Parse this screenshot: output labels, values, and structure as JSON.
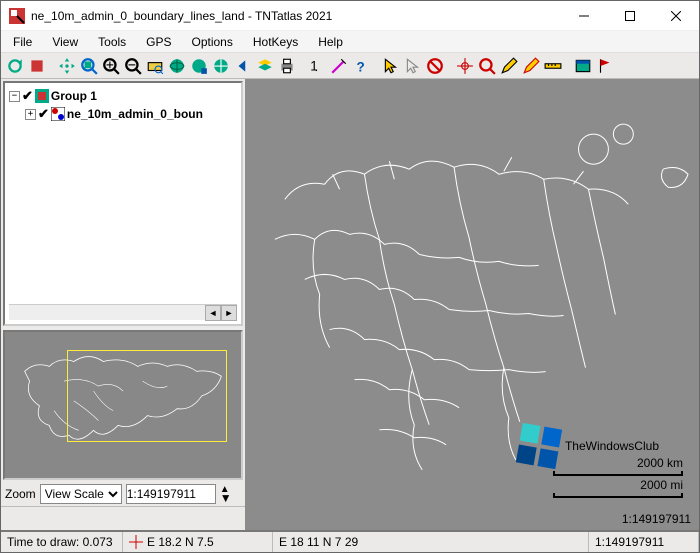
{
  "window": {
    "title": "ne_10m_admin_0_boundary_lines_land - TNTatlas 2021"
  },
  "menu": {
    "file": "File",
    "view": "View",
    "tools": "Tools",
    "gps": "GPS",
    "options": "Options",
    "hotkeys": "HotKeys",
    "help": "Help"
  },
  "layers": {
    "group_label": "Group 1",
    "layer_label": "ne_10m_admin_0_boun"
  },
  "zoom": {
    "label": "Zoom",
    "mode": "View Scale",
    "value": "1:149197911"
  },
  "status": {
    "draw_time": "Time to draw: 0.073",
    "coords": "E 18.2  N 7.5",
    "coords2": "E 18 11  N 7 29",
    "scale": "1:149197911"
  },
  "scalebar": {
    "km": "2000 km",
    "mi": "2000 mi"
  },
  "watermark": {
    "text": "TheWindowsClub"
  }
}
